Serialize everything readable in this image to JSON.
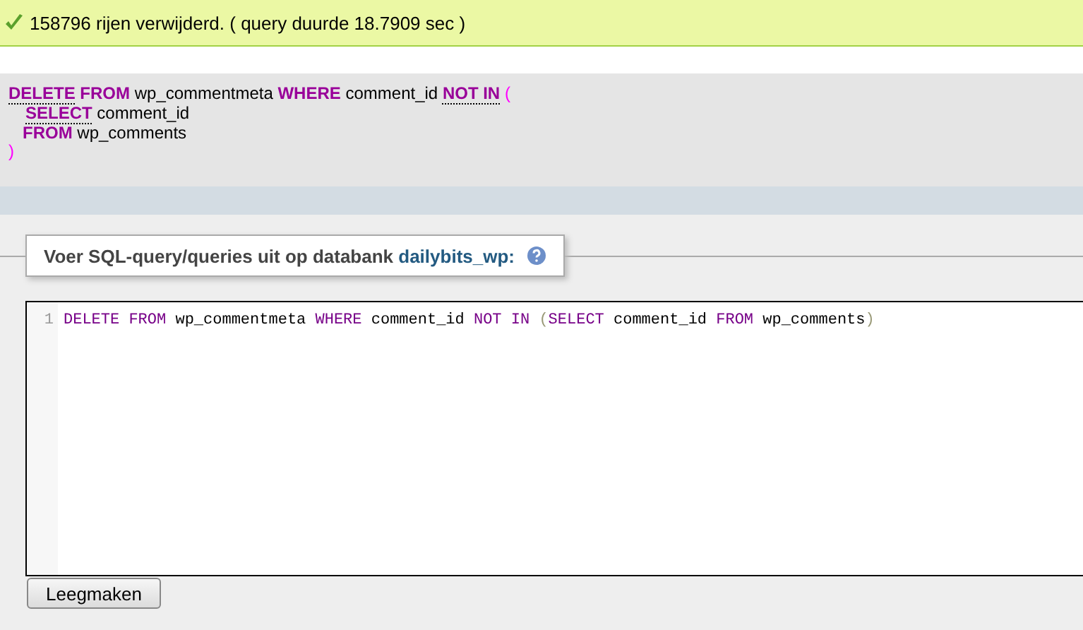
{
  "message": {
    "text": "158796 rijen verwijderd. ( query duurde 18.7909 sec )"
  },
  "sql_preview": {
    "lines": [
      [
        {
          "text": "DELETE",
          "kind": "keyword",
          "link": true
        },
        {
          "text": " FROM",
          "kind": "keyword",
          "link": false
        },
        {
          "text": " wp_commentmeta ",
          "kind": "plain",
          "link": false
        },
        {
          "text": "WHERE",
          "kind": "keyword",
          "link": false
        },
        {
          "text": " comment_id ",
          "kind": "plain",
          "link": false
        },
        {
          "text": "NOT IN",
          "kind": "keyword",
          "link": true
        },
        {
          "text": " (",
          "kind": "paren",
          "link": false
        }
      ],
      [
        {
          "text": "SELECT",
          "kind": "keyword",
          "link": true
        },
        {
          "text": " comment_id",
          "kind": "plain",
          "link": false
        }
      ],
      [
        {
          "text": "FROM",
          "kind": "keyword",
          "link": false
        },
        {
          "text": " wp_comments",
          "kind": "plain",
          "link": false
        }
      ],
      [
        {
          "text": ")",
          "kind": "paren",
          "link": false
        }
      ]
    ]
  },
  "query_box": {
    "legend": "Voer SQL-query/queries uit op databank ",
    "database": "dailybits_wp:",
    "editor": {
      "line_number": "1",
      "tokens": [
        {
          "text": "DELETE FROM",
          "kind": "keyword"
        },
        {
          "text": " wp_commentmeta ",
          "kind": "plain"
        },
        {
          "text": "WHERE",
          "kind": "keyword"
        },
        {
          "text": " comment_id ",
          "kind": "plain"
        },
        {
          "text": "NOT IN",
          "kind": "keyword"
        },
        {
          "text": " (",
          "kind": "paren"
        },
        {
          "text": "SELECT",
          "kind": "keyword"
        },
        {
          "text": " comment_id ",
          "kind": "plain"
        },
        {
          "text": "FROM",
          "kind": "keyword"
        },
        {
          "text": " wp_comments",
          "kind": "plain"
        },
        {
          "text": ")",
          "kind": "paren"
        }
      ]
    },
    "buttons": [
      "Leegmaken"
    ]
  }
}
